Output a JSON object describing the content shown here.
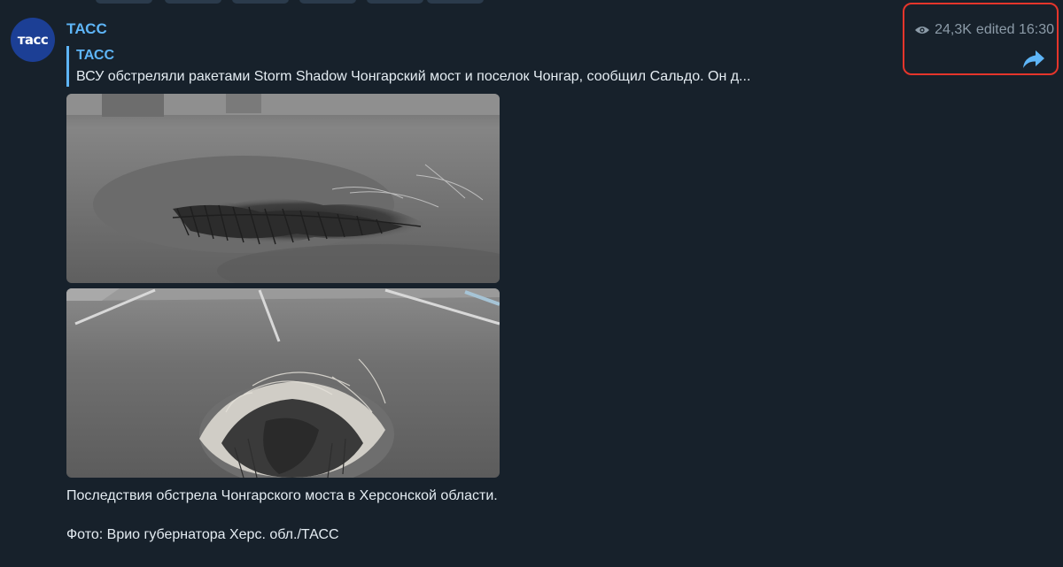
{
  "post": {
    "channel_name": "ТАСС",
    "avatar_text": "тасс",
    "avatar_color": "#1c3f95",
    "accent_color": "#5eb5f7",
    "reply": {
      "author": "ТАСС",
      "text": "ВСУ обстреляли ракетами Storm Shadow Чонгарский мост и поселок Чонгар, сообщил Сальдо. Он д..."
    },
    "photos": [
      {
        "name": "bridge-crater-photo-1",
        "icon": "photo"
      },
      {
        "name": "bridge-crater-photo-2",
        "icon": "photo"
      }
    ],
    "caption_line1": "Последствия обстрела Чонгарского моста в Херсонской области.",
    "caption_credit": "Фото: Врио губернатора Херс. обл./ТАСС",
    "meta": {
      "views": "24,3K",
      "edited_time": "edited 16:30",
      "views_icon": "eye-icon",
      "share_icon": "share-arrow-icon"
    },
    "highlight_color": "#e5352b"
  }
}
